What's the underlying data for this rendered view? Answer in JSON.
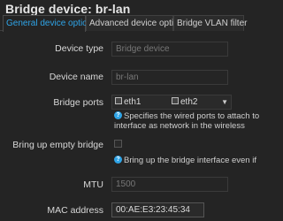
{
  "dialog": {
    "title": "Bridge device: br-lan"
  },
  "tabs": [
    {
      "label": "General device options",
      "active": true
    },
    {
      "label": "Advanced device options",
      "active": false
    },
    {
      "label": "Bridge VLAN filter",
      "active": false
    }
  ],
  "form": {
    "device_type": {
      "label": "Device type",
      "value": "Bridge device"
    },
    "device_name": {
      "label": "Device name",
      "value": "br-lan"
    },
    "bridge_ports": {
      "label": "Bridge ports",
      "ports": [
        "eth1",
        "eth2"
      ],
      "help_line1": "Specifies the wired ports to attach to",
      "help_line2": "interface as network in the wireless"
    },
    "empty_bridge": {
      "label": "Bring up empty bridge",
      "checked": false,
      "help": "Bring up the bridge interface even if"
    },
    "mtu": {
      "label": "MTU",
      "placeholder": "1500"
    },
    "mac": {
      "label": "MAC address",
      "value": "00:AE:E3:23:45:34"
    }
  },
  "colors": {
    "accent": "#2fa4e7",
    "background": "#242424"
  }
}
